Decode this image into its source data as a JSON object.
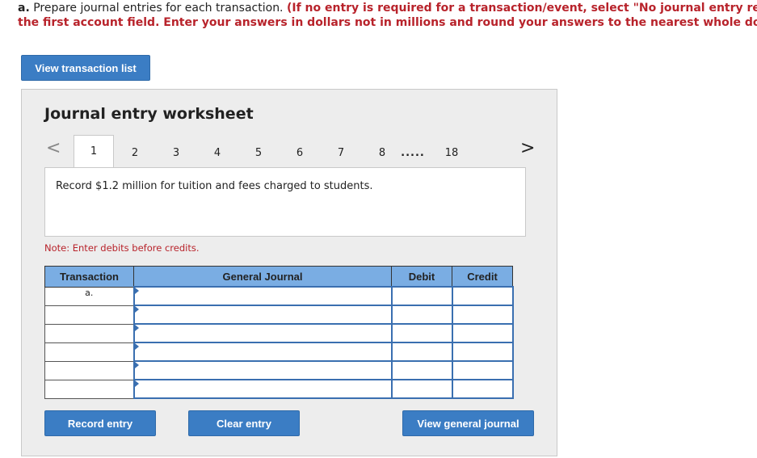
{
  "instructions": {
    "label": "a.",
    "plain": "Prepare journal entries for each transaction.",
    "red_line1": "(If no entry is required for a transaction/event, select \"No journal entry required\" i",
    "red_line2": "the first account field. Enter your answers in dollars not in millions and round your answers to the nearest whole dollar amount."
  },
  "view_transaction_list_label": "View transaction list",
  "worksheet": {
    "title": "Journal entry worksheet",
    "nav_prev": "<",
    "nav_next": ">",
    "tabs": [
      "1",
      "2",
      "3",
      "4",
      "5",
      "6",
      "7",
      "8",
      ".....",
      "18"
    ],
    "active_tab": "1",
    "description": "Record $1.2 million for tuition and fees charged to students.",
    "note": "Note: Enter debits before credits."
  },
  "table": {
    "headers": [
      "Transaction",
      "General Journal",
      "Debit",
      "Credit"
    ],
    "rows": [
      {
        "transaction": "a.",
        "account": "",
        "debit": "",
        "credit": ""
      },
      {
        "transaction": "",
        "account": "",
        "debit": "",
        "credit": ""
      },
      {
        "transaction": "",
        "account": "",
        "debit": "",
        "credit": ""
      },
      {
        "transaction": "",
        "account": "",
        "debit": "",
        "credit": ""
      },
      {
        "transaction": "",
        "account": "",
        "debit": "",
        "credit": ""
      },
      {
        "transaction": "",
        "account": "",
        "debit": "",
        "credit": ""
      }
    ]
  },
  "buttons": {
    "record_entry": "Record entry",
    "clear_entry": "Clear entry",
    "view_general_journal": "View general journal"
  },
  "colors": {
    "button_blue": "#3b7dc4",
    "header_blue": "#7aade3",
    "instruction_red": "#b8232b"
  }
}
